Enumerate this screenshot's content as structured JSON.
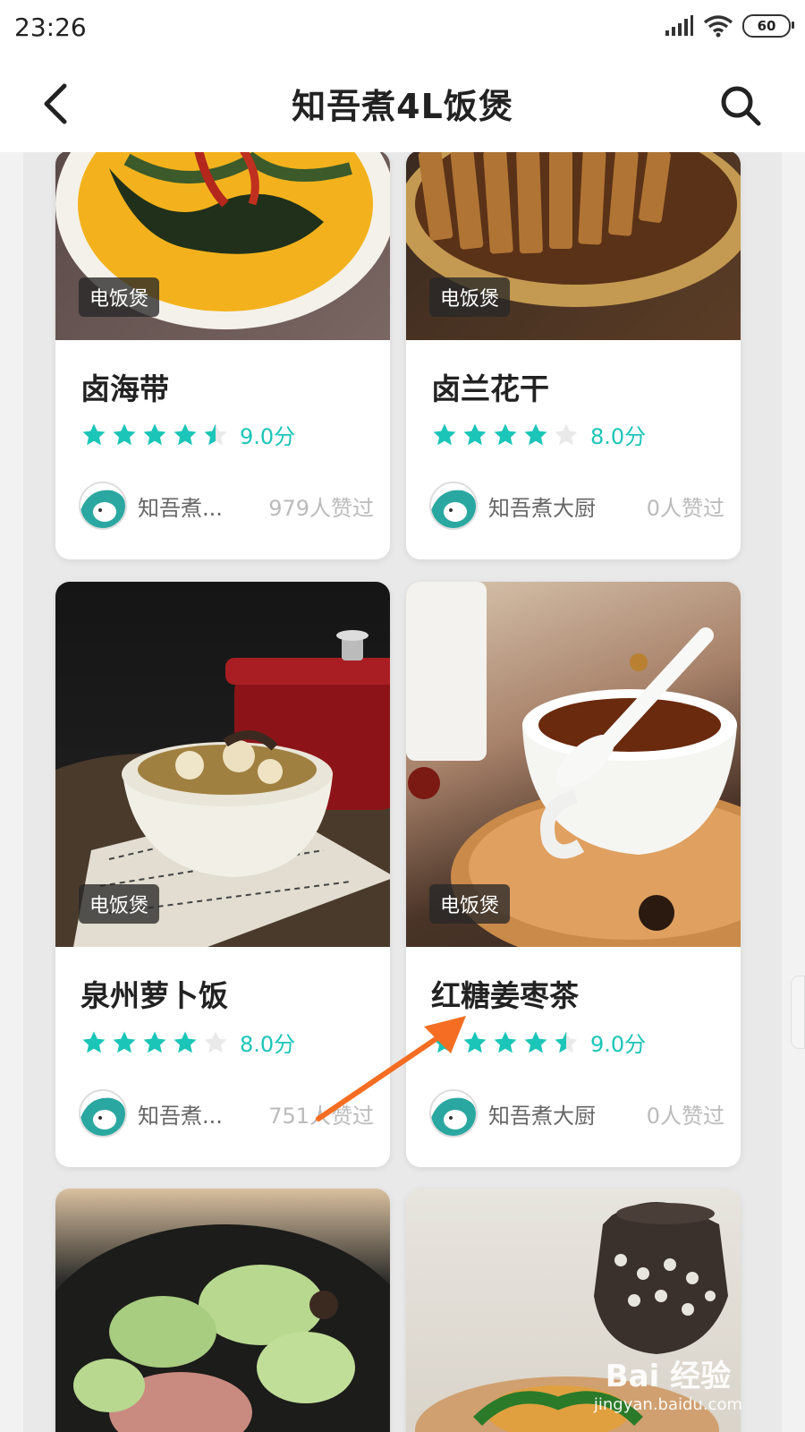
{
  "status_bar": {
    "time": "23:26",
    "battery": "60",
    "icons": [
      "signal-icon",
      "wifi-icon",
      "battery-icon"
    ]
  },
  "header": {
    "back_icon": "chevron-left-icon",
    "title": "知吾煮4L饭煲",
    "search_icon": "search-icon"
  },
  "accent_color": "#1bc5b8",
  "recipes": [
    {
      "tag": "电饭煲",
      "name": "卤海带",
      "score": "9.0分",
      "rating": 4.5,
      "author": "知吾煮...",
      "likes": "979人赞过"
    },
    {
      "tag": "电饭煲",
      "name": "卤兰花干",
      "score": "8.0分",
      "rating": 4,
      "author": "知吾煮大厨",
      "likes": "0人赞过"
    },
    {
      "tag": "电饭煲",
      "name": "泉州萝卜饭",
      "score": "8.0分",
      "rating": 4,
      "author": "知吾煮...",
      "likes": "751人赞过"
    },
    {
      "tag": "电饭煲",
      "name": "红糖姜枣茶",
      "score": "9.0分",
      "rating": 4.5,
      "author": "知吾煮大厨",
      "likes": "0人赞过"
    },
    {
      "tag": "",
      "name": "",
      "score": "",
      "rating": null,
      "author": "",
      "likes": ""
    },
    {
      "tag": "",
      "name": "",
      "score": "",
      "rating": null,
      "author": "",
      "likes": ""
    }
  ],
  "watermark": {
    "main": "Bai 经验",
    "sub": "jingyan.baidu.com"
  }
}
